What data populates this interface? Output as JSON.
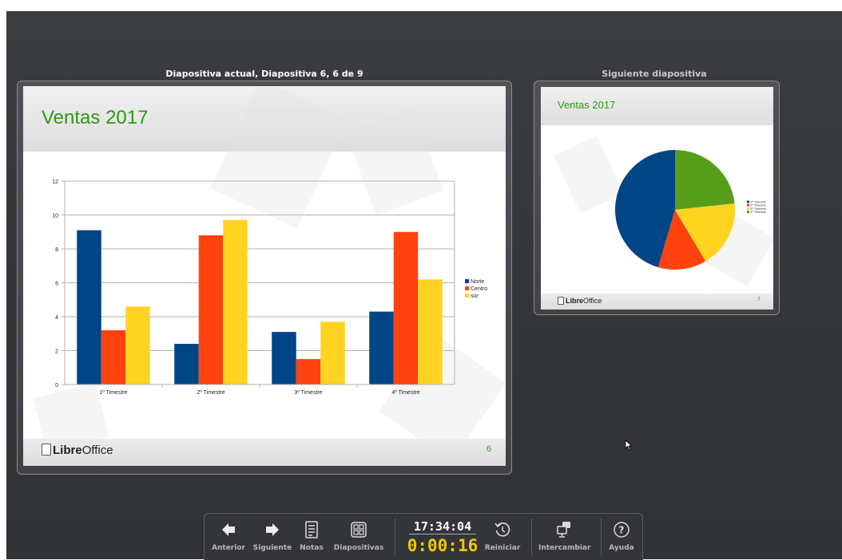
{
  "current_slide": {
    "caption": "Diapositiva actual, Diapositiva 6, 6 de 9",
    "title": "Ventas 2017",
    "page_number": "6",
    "logo_bold": "Libre",
    "logo_regular": "Office"
  },
  "next_slide": {
    "caption": "Siguiente diapositiva",
    "title": "Ventas 2017",
    "page_number": "7",
    "logo_bold": "Libre",
    "logo_regular": "Office"
  },
  "toolbar": {
    "prev_label": "Anterior",
    "next_label": "Siguiente",
    "notes_label": "Notas",
    "slides_label": "Diapositivas",
    "clock": "17:34:04",
    "timer": "0:00:16",
    "restart_label": "Reiniciar",
    "exchange_label": "Intercambiar",
    "help_label": "Ayuda"
  },
  "chart_data": [
    {
      "type": "bar",
      "categories": [
        "1º Timestre",
        "2º Timestre",
        "3º Timestre",
        "4º Timestre"
      ],
      "series": [
        {
          "name": "Norte",
          "color": "#004586",
          "values": [
            9.1,
            2.4,
            3.1,
            4.3
          ]
        },
        {
          "name": "Centro",
          "color": "#ff420e",
          "values": [
            3.2,
            8.8,
            1.5,
            9.0
          ]
        },
        {
          "name": "sur",
          "color": "#ffd320",
          "values": [
            4.6,
            9.7,
            3.7,
            6.2
          ]
        }
      ],
      "ylim": [
        0,
        12
      ],
      "yticks": [
        0,
        2,
        4,
        6,
        8,
        10,
        12
      ],
      "grid": true,
      "legend": "right"
    },
    {
      "type": "pie",
      "labels": [
        "1º Timestre",
        "2º Timestre",
        "3º Timestre",
        "4º Timestre"
      ],
      "values": [
        8.0,
        2.3,
        3.2,
        4.1
      ],
      "colors": [
        "#004586",
        "#ff420e",
        "#ffd320",
        "#579d1c"
      ],
      "legend": "right"
    }
  ]
}
